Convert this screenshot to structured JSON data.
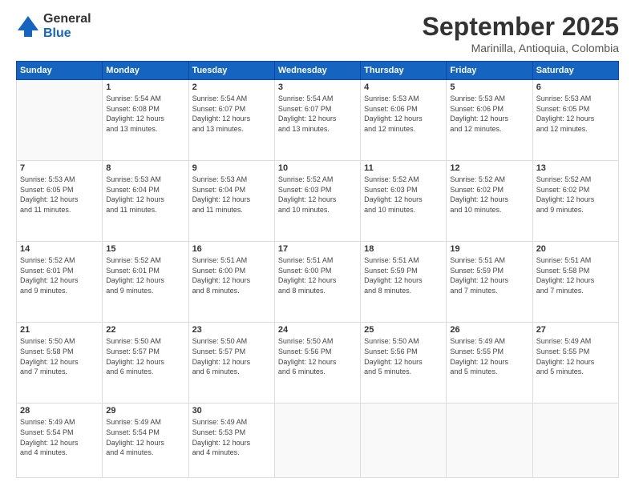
{
  "logo": {
    "general": "General",
    "blue": "Blue"
  },
  "header": {
    "month": "September 2025",
    "location": "Marinilla, Antioquia, Colombia"
  },
  "days_of_week": [
    "Sunday",
    "Monday",
    "Tuesday",
    "Wednesday",
    "Thursday",
    "Friday",
    "Saturday"
  ],
  "weeks": [
    [
      {
        "day": "",
        "info": ""
      },
      {
        "day": "1",
        "info": "Sunrise: 5:54 AM\nSunset: 6:08 PM\nDaylight: 12 hours\nand 13 minutes."
      },
      {
        "day": "2",
        "info": "Sunrise: 5:54 AM\nSunset: 6:07 PM\nDaylight: 12 hours\nand 13 minutes."
      },
      {
        "day": "3",
        "info": "Sunrise: 5:54 AM\nSunset: 6:07 PM\nDaylight: 12 hours\nand 13 minutes."
      },
      {
        "day": "4",
        "info": "Sunrise: 5:53 AM\nSunset: 6:06 PM\nDaylight: 12 hours\nand 12 minutes."
      },
      {
        "day": "5",
        "info": "Sunrise: 5:53 AM\nSunset: 6:06 PM\nDaylight: 12 hours\nand 12 minutes."
      },
      {
        "day": "6",
        "info": "Sunrise: 5:53 AM\nSunset: 6:05 PM\nDaylight: 12 hours\nand 12 minutes."
      }
    ],
    [
      {
        "day": "7",
        "info": "Sunrise: 5:53 AM\nSunset: 6:05 PM\nDaylight: 12 hours\nand 11 minutes."
      },
      {
        "day": "8",
        "info": "Sunrise: 5:53 AM\nSunset: 6:04 PM\nDaylight: 12 hours\nand 11 minutes."
      },
      {
        "day": "9",
        "info": "Sunrise: 5:53 AM\nSunset: 6:04 PM\nDaylight: 12 hours\nand 11 minutes."
      },
      {
        "day": "10",
        "info": "Sunrise: 5:52 AM\nSunset: 6:03 PM\nDaylight: 12 hours\nand 10 minutes."
      },
      {
        "day": "11",
        "info": "Sunrise: 5:52 AM\nSunset: 6:03 PM\nDaylight: 12 hours\nand 10 minutes."
      },
      {
        "day": "12",
        "info": "Sunrise: 5:52 AM\nSunset: 6:02 PM\nDaylight: 12 hours\nand 10 minutes."
      },
      {
        "day": "13",
        "info": "Sunrise: 5:52 AM\nSunset: 6:02 PM\nDaylight: 12 hours\nand 9 minutes."
      }
    ],
    [
      {
        "day": "14",
        "info": "Sunrise: 5:52 AM\nSunset: 6:01 PM\nDaylight: 12 hours\nand 9 minutes."
      },
      {
        "day": "15",
        "info": "Sunrise: 5:52 AM\nSunset: 6:01 PM\nDaylight: 12 hours\nand 9 minutes."
      },
      {
        "day": "16",
        "info": "Sunrise: 5:51 AM\nSunset: 6:00 PM\nDaylight: 12 hours\nand 8 minutes."
      },
      {
        "day": "17",
        "info": "Sunrise: 5:51 AM\nSunset: 6:00 PM\nDaylight: 12 hours\nand 8 minutes."
      },
      {
        "day": "18",
        "info": "Sunrise: 5:51 AM\nSunset: 5:59 PM\nDaylight: 12 hours\nand 8 minutes."
      },
      {
        "day": "19",
        "info": "Sunrise: 5:51 AM\nSunset: 5:59 PM\nDaylight: 12 hours\nand 7 minutes."
      },
      {
        "day": "20",
        "info": "Sunrise: 5:51 AM\nSunset: 5:58 PM\nDaylight: 12 hours\nand 7 minutes."
      }
    ],
    [
      {
        "day": "21",
        "info": "Sunrise: 5:50 AM\nSunset: 5:58 PM\nDaylight: 12 hours\nand 7 minutes."
      },
      {
        "day": "22",
        "info": "Sunrise: 5:50 AM\nSunset: 5:57 PM\nDaylight: 12 hours\nand 6 minutes."
      },
      {
        "day": "23",
        "info": "Sunrise: 5:50 AM\nSunset: 5:57 PM\nDaylight: 12 hours\nand 6 minutes."
      },
      {
        "day": "24",
        "info": "Sunrise: 5:50 AM\nSunset: 5:56 PM\nDaylight: 12 hours\nand 6 minutes."
      },
      {
        "day": "25",
        "info": "Sunrise: 5:50 AM\nSunset: 5:56 PM\nDaylight: 12 hours\nand 5 minutes."
      },
      {
        "day": "26",
        "info": "Sunrise: 5:49 AM\nSunset: 5:55 PM\nDaylight: 12 hours\nand 5 minutes."
      },
      {
        "day": "27",
        "info": "Sunrise: 5:49 AM\nSunset: 5:55 PM\nDaylight: 12 hours\nand 5 minutes."
      }
    ],
    [
      {
        "day": "28",
        "info": "Sunrise: 5:49 AM\nSunset: 5:54 PM\nDaylight: 12 hours\nand 4 minutes."
      },
      {
        "day": "29",
        "info": "Sunrise: 5:49 AM\nSunset: 5:54 PM\nDaylight: 12 hours\nand 4 minutes."
      },
      {
        "day": "30",
        "info": "Sunrise: 5:49 AM\nSunset: 5:53 PM\nDaylight: 12 hours\nand 4 minutes."
      },
      {
        "day": "",
        "info": ""
      },
      {
        "day": "",
        "info": ""
      },
      {
        "day": "",
        "info": ""
      },
      {
        "day": "",
        "info": ""
      }
    ]
  ]
}
